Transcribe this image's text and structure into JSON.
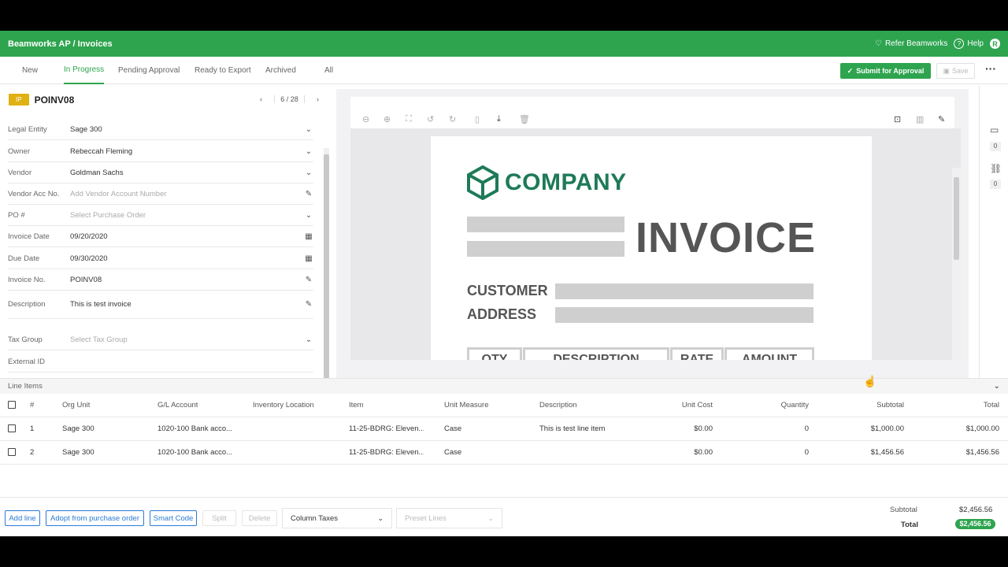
{
  "header": {
    "title": "Beamworks AP / Invoices",
    "refer": "Refer Beamworks",
    "help": "Help",
    "avatar": "R"
  },
  "tabs": [
    {
      "label": "New"
    },
    {
      "label": "In Progress"
    },
    {
      "label": "Pending Approval"
    },
    {
      "label": "Ready to Export"
    },
    {
      "label": "Archived"
    },
    {
      "label": "All"
    }
  ],
  "active_tab": "In Progress",
  "actions": {
    "submit": "Submit for Approval",
    "save": "Save"
  },
  "invoice": {
    "status_badge": "IP",
    "number": "POINV08",
    "pager": "6 / 28"
  },
  "fields": [
    {
      "label": "Legal Entity",
      "value": "Sage 300",
      "placeholder": false,
      "icon": "chevron-down-icon"
    },
    {
      "label": "Owner",
      "value": "Rebeccah Fleming",
      "placeholder": false,
      "icon": "chevron-down-icon"
    },
    {
      "label": "Vendor",
      "value": "Goldman Sachs",
      "placeholder": false,
      "icon": "chevron-down-icon"
    },
    {
      "label": "Vendor Acc No.",
      "value": "Add Vendor Account Number",
      "placeholder": true,
      "icon": "pencil-icon"
    },
    {
      "label": "PO #",
      "value": "Select Purchase Order",
      "placeholder": true,
      "icon": "chevron-down-icon"
    },
    {
      "label": "Invoice Date",
      "value": "09/20/2020",
      "placeholder": false,
      "icon": "calendar-icon"
    },
    {
      "label": "Due Date",
      "value": "09/30/2020",
      "placeholder": false,
      "icon": "calendar-icon"
    },
    {
      "label": "Invoice No.",
      "value": "POINV08",
      "placeholder": false,
      "icon": "pencil-icon"
    },
    {
      "label": "Description",
      "value": "This is test invoice",
      "placeholder": false,
      "icon": "pencil-icon"
    },
    {
      "label": "Tax Group",
      "value": "Select Tax Group",
      "placeholder": true,
      "icon": "chevron-down-icon"
    },
    {
      "label": "External ID",
      "value": "",
      "placeholder": false,
      "icon": ""
    }
  ],
  "document": {
    "company": "COMPANY",
    "invoice_word": "INVOICE",
    "customer_label": "CUSTOMER",
    "address_label": "ADDRESS",
    "table_headers": [
      "QTY",
      "DESCRIPTION",
      "RATE",
      "AMOUNT"
    ]
  },
  "rail": {
    "comments_count": "0",
    "links_count": "0"
  },
  "line_items": {
    "section_title": "Line Items",
    "columns": [
      "#",
      "Org Unit",
      "G/L Account",
      "Inventory Location",
      "Item",
      "Unit Measure",
      "Description",
      "Unit Cost",
      "Quantity",
      "Subtotal",
      "Total"
    ],
    "rows": [
      [
        "1",
        "Sage 300",
        "1020-100 Bank acco...",
        "",
        "11-25-BDRG: Eleven...",
        "Case",
        "This is test line item",
        "$0.00",
        "0",
        "$1,000.00",
        "$1,000.00"
      ],
      [
        "2",
        "Sage 300",
        "1020-100 Bank acco...",
        "",
        "11-25-BDRG: Eleven...",
        "Case",
        "",
        "$0.00",
        "0",
        "$1,456.56",
        "$1,456.56"
      ]
    ]
  },
  "footer": {
    "add_line": "Add line",
    "adopt": "Adopt from purchase order",
    "smart_code": "Smart Code",
    "split": "Split",
    "delete": "Delete",
    "column_taxes": "Column Taxes",
    "preset_lines": "Preset Lines",
    "subtotal_label": "Subtotal",
    "subtotal_value": "$2,456.56",
    "total_label": "Total",
    "total_value": "$2,456.56"
  },
  "colors": {
    "brand": "#2ea44f",
    "status_ip": "#e0b113",
    "link_blue": "#2a7bd6"
  }
}
